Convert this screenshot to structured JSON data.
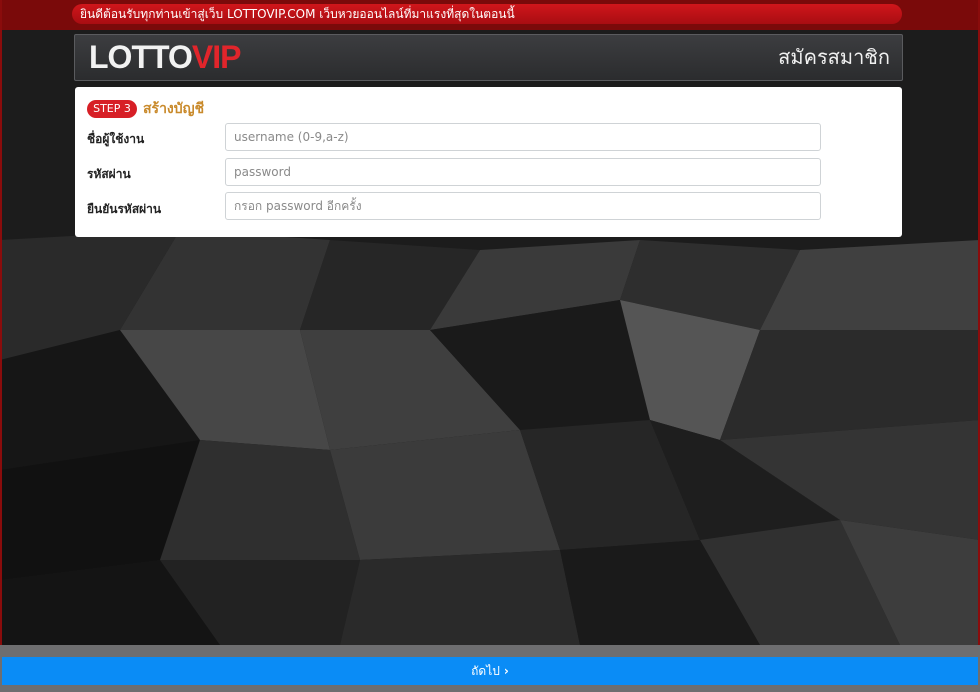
{
  "marquee": {
    "text": "ยินดีต้อนรับทุกท่านเข้าสู่เว็บ LOTTOVIP.COM เว็บหวยออนไลน์ที่มาแรงที่สุดในตอนนี้"
  },
  "header": {
    "logo_white": "LOTTO",
    "logo_red": "VIP",
    "title": "สมัครสมาชิก"
  },
  "step": {
    "badge": "STEP 3",
    "title": "สร้างบัญชี"
  },
  "form": {
    "fields": [
      {
        "label": "ชื่อผู้ใช้งาน",
        "placeholder": "username (0-9,a-z)",
        "value": ""
      },
      {
        "label": "รหัสผ่าน",
        "placeholder": "password",
        "value": ""
      },
      {
        "label": "ยืนยันรหัสผ่าน",
        "placeholder": "กรอก password อีกครั้ง",
        "value": ""
      }
    ]
  },
  "footer": {
    "next_label": "ถัดไป",
    "next_icon": "chevron-right-icon"
  },
  "colors": {
    "brand_red": "#d71f26",
    "step_title": "#c98a2b",
    "next_button": "#0a8cf6"
  }
}
